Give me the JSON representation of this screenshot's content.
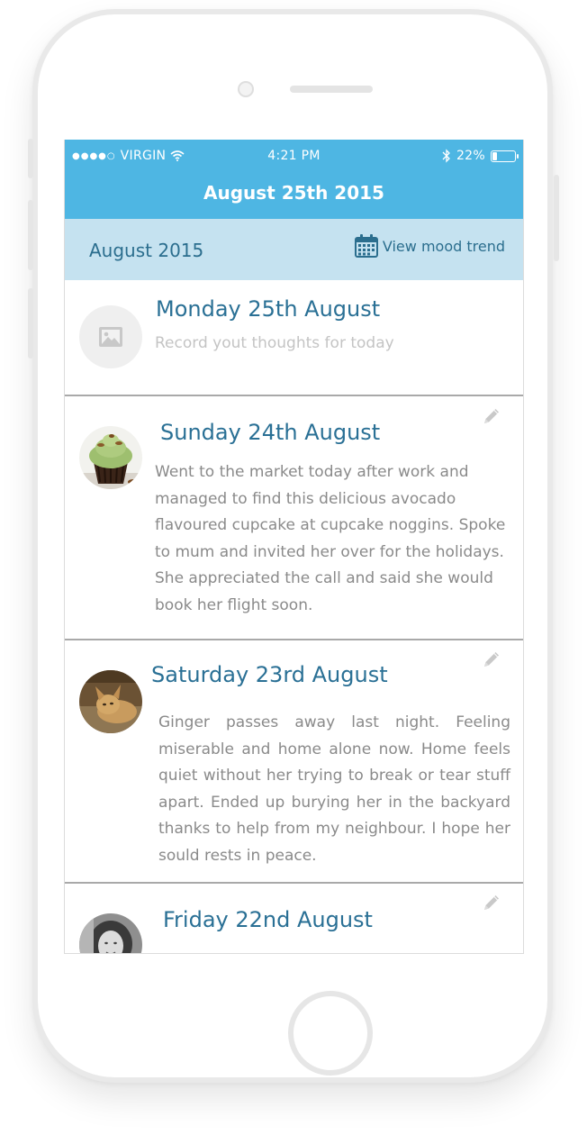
{
  "status_bar": {
    "carrier": "VIRGIN",
    "time": "4:21 PM",
    "battery_percent": "22%",
    "battery_level": 0.22
  },
  "nav": {
    "title": "August 25th 2015"
  },
  "subheader": {
    "month": "August 2015",
    "mood_trend_label": "View mood trend"
  },
  "entries": [
    {
      "title": "Monday 25th August",
      "text": "Record yout thoughts for today",
      "avatar": "image-placeholder-icon"
    },
    {
      "title": "Sunday 24th August",
      "text": "Went to the market today after work and managed to find this delicious avocado flavoured cupcake at cupcake noggins. Spoke to mum and invited her over for the holidays. She appreciated the call and said she would book her flight soon.",
      "avatar": "cupcake-photo"
    },
    {
      "title": "Saturday 23rd August",
      "text": "Ginger passes away last night. Feeling miserable and home alone now. Home feels quiet without her trying to break or tear stuff apart. Ended up burying her in the backyard thanks to help from my neighbour. I hope her sould rests in peace.",
      "avatar": "cat-photo"
    },
    {
      "title": "Friday 22nd August",
      "text": "",
      "avatar": "person-photo"
    }
  ],
  "colors": {
    "nav_blue": "#4eb6e3",
    "subheader_blue": "#c5e2f0",
    "title_blue": "#2a7095",
    "body_gray": "#8a8a8a",
    "placeholder_gray": "#c4c4c4"
  }
}
